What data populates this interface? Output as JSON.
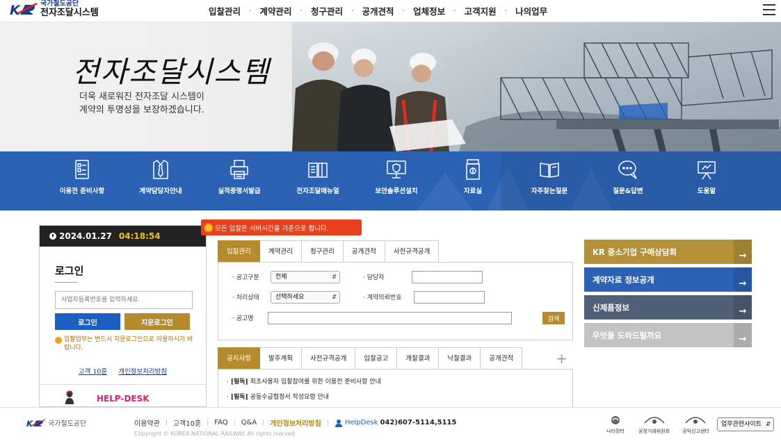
{
  "header": {
    "org_name": "국가철도공단",
    "system_name": "전자조달시스템",
    "nav": [
      "입찰관리",
      "계약관리",
      "청구관리",
      "공개견적",
      "업체정보",
      "고객지원",
      "나의업무"
    ],
    "nav_separator": "·"
  },
  "hero": {
    "title": "전자조달시스템",
    "subtitle_line1": "더욱 새로워진 전자조달 시스템이",
    "subtitle_line2": "계약의 투명성을 보장하겠습니다.",
    "slides_total": 3,
    "active_slide": 3
  },
  "quick_menu": [
    {
      "label": "이용전 준비사항",
      "icon": "checklist-icon"
    },
    {
      "label": "계약담당자안내",
      "icon": "staff-tie-icon"
    },
    {
      "label": "실적증명서발급",
      "icon": "printer-icon"
    },
    {
      "label": "전자조달매뉴얼",
      "icon": "manual-book-icon"
    },
    {
      "label": "보안솔루션설치",
      "icon": "security-monitor-icon"
    },
    {
      "label": "자료실",
      "icon": "archive-icon"
    },
    {
      "label": "자주찾는질문",
      "icon": "faq-book-icon"
    },
    {
      "label": "질문&답변",
      "icon": "qna-bubble-icon"
    },
    {
      "label": "도움말",
      "icon": "help-board-icon"
    }
  ],
  "clock": {
    "date": "2024.01.27",
    "time": "04:18:54"
  },
  "login": {
    "title": "로그인",
    "input_placeholder": "사업자등록번호를 입력하세요.",
    "login_button": "로그인",
    "fingerprint_button": "지문로그인",
    "note": "입찰업무는 반드시 지문로그인으로 이용하시기 바랍니다.",
    "link_ten_rules": "고객 10훈",
    "link_privacy": "개인정보처리방침",
    "helpdesk": "HELP-DESK"
  },
  "notice": "모든 입찰은 서버시간을 기준으로 합니다.",
  "search": {
    "tabs": [
      "입찰관리",
      "계약관리",
      "청구관리",
      "공개견적",
      "사전규격공개"
    ],
    "active_tab": 0,
    "label_notice_type": "· 공고구분",
    "notice_type_value": "전체",
    "label_manager": "· 담당자",
    "label_status": "· 처리상태",
    "status_value": "선택하세요",
    "label_contract_no": "· 계약의뢰번호",
    "label_notice_name": "· 공고명",
    "search_button": "검색"
  },
  "board": {
    "tabs": [
      "공지사항",
      "발주계획",
      "사전규격공개",
      "입찰공고",
      "개찰결과",
      "낙찰결과",
      "공개견적"
    ],
    "active_tab": 0,
    "more": "+",
    "items": [
      {
        "tag": "[필독]",
        "title": "최초사용자 입찰참여를 위한 이용전 준비사항 안내"
      },
      {
        "tag": "[필독]",
        "title": "공동수급협정서 작성요령 안내"
      }
    ]
  },
  "right_menu": [
    {
      "label": "KR 중소기업 구매상담회",
      "color": "#b5913a"
    },
    {
      "label": "계약자료 정보공개",
      "color": "#2b62b5"
    },
    {
      "label": "신제품정보",
      "color": "#4f6076"
    },
    {
      "label": "무엇을 도와드릴까요",
      "color": "#c3c3c3"
    }
  ],
  "right_menu_arrow": "→",
  "footer": {
    "org_name": "국가철도공단",
    "links": [
      "이용약관",
      "고객10훈",
      "FAQ",
      "Q&A"
    ],
    "privacy": "개인정보처리방침",
    "helpdesk_label": "HelpDesk",
    "helpdesk_number": "042)607-5114,5115",
    "copyright": "Copyright © KOREA NATIONAL RAILWAY. All rights rserved.",
    "badges": [
      "나라장터",
      "공정거래위원회",
      "공익신고센터"
    ],
    "site_select": "업무관련사이트"
  },
  "colors": {
    "brand_blue": "#1b5fc1",
    "gold": "#b68b2e",
    "quickbar": "#2c62b4",
    "notice_red": "#e8401c",
    "clock_highlight": "#f5c400"
  }
}
